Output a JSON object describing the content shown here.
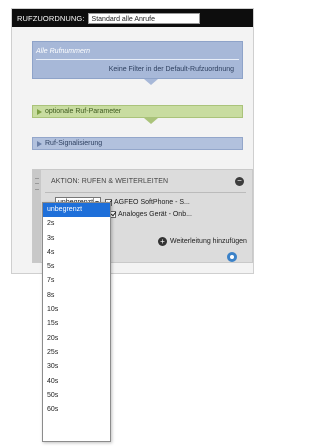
{
  "header": {
    "label": "RUFZUORDNUNG:",
    "input_value": "Standard  alle Anrufe"
  },
  "rule": {
    "title": "Alle Rufnummern",
    "description": "Keine Filter in der Default-Rufzuordnung"
  },
  "sections": {
    "optional_params": "optionale Ruf-Parameter",
    "signaling": "Ruf-Signalisierung"
  },
  "action": {
    "title": "AKTION: RUFEN & WEITERLEITEN",
    "minus_icon": "−",
    "rows": [
      {
        "delay": "unbegrenzt",
        "checked": true,
        "destination": "AGFEO SoftPhone - S..."
      },
      {
        "delay": "",
        "checked": true,
        "destination": "Analoges Gerät - Onb..."
      }
    ],
    "add_label": "Weiterleitung hinzufügen",
    "add_icon": "+"
  },
  "dropdown": {
    "selected": "unbegrenzt",
    "options": [
      "unbegrenzt",
      "2s",
      "3s",
      "4s",
      "5s",
      "7s",
      "8s",
      "10s",
      "15s",
      "20s",
      "25s",
      "30s",
      "40s",
      "50s",
      "60s"
    ]
  },
  "icons": {
    "grip": "drag-handle-icon",
    "settings": "settings-icon"
  },
  "colors": {
    "header_bg": "#0d0d0d",
    "rule_bg": "#a7b8d8",
    "green_bar": "#c8dca0",
    "blue_bar": "#b2c1dd",
    "selected_option": "#1e6fd9"
  }
}
